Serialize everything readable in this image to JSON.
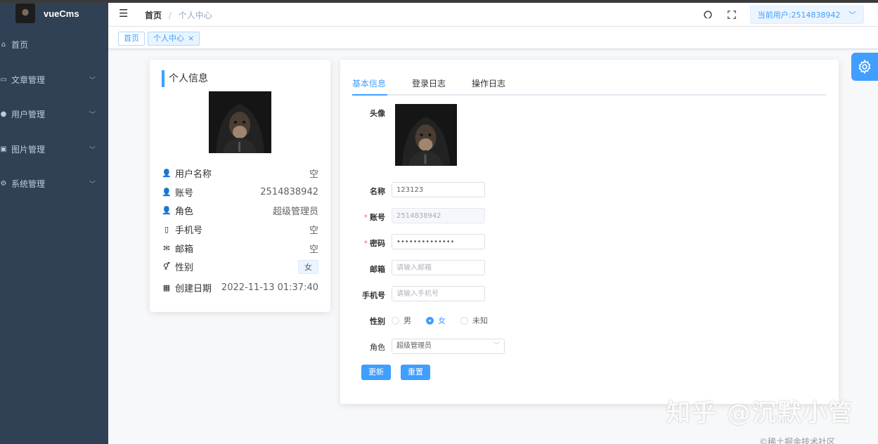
{
  "app": {
    "title": "vueCms"
  },
  "sidebar": {
    "items": [
      {
        "label": "首页",
        "icon": "home-icon",
        "has_sub": false
      },
      {
        "label": "文章管理",
        "icon": "article-icon",
        "has_sub": true
      },
      {
        "label": "用户管理",
        "icon": "user-icon",
        "has_sub": true
      },
      {
        "label": "图片管理",
        "icon": "image-icon",
        "has_sub": true
      },
      {
        "label": "系统管理",
        "icon": "settings-icon",
        "has_sub": true
      }
    ]
  },
  "header": {
    "breadcrumb": [
      "首页",
      "个人中心"
    ],
    "separator": "/",
    "current_user": "当前用户:2514838942"
  },
  "tags": {
    "home": "首页",
    "active": "个人中心",
    "close": "×"
  },
  "profile_card": {
    "title": "个人信息",
    "rows": [
      {
        "label": "用户名称",
        "value": "空",
        "icon": "user-icon"
      },
      {
        "label": "账号",
        "value": "2514838942",
        "icon": "user-icon"
      },
      {
        "label": "角色",
        "value": "超级管理员",
        "icon": "user-icon"
      },
      {
        "label": "手机号",
        "value": "空",
        "icon": "phone-icon"
      },
      {
        "label": "邮箱",
        "value": "空",
        "icon": "mail-icon"
      },
      {
        "label": "性别",
        "value": "女",
        "icon": "gender-icon"
      },
      {
        "label": "创建日期",
        "value": "2022-11-13 01:37:40",
        "icon": "calendar-icon"
      }
    ]
  },
  "tabs": [
    "基本信息",
    "登录日志",
    "操作日志"
  ],
  "form": {
    "avatar_label": "头像",
    "name_label": "名称",
    "name_value": "123123",
    "account_label": "账号",
    "account_value": "2514838942",
    "password_label": "密码",
    "password_value": "••••••••••••••",
    "email_label": "邮箱",
    "email_placeholder": "请输入邮箱",
    "phone_label": "手机号",
    "phone_placeholder": "请输入手机号",
    "gender_label": "性别",
    "gender_options": [
      "男",
      "女",
      "未知"
    ],
    "gender_selected": "女",
    "role_label": "角色",
    "role_value": "超级管理员",
    "update_button": "更新",
    "reset_button": "重置"
  },
  "watermark": "知乎 @沉默小管",
  "footer": "©稀土掘金技术社区",
  "colors": {
    "accent": "#409eff",
    "sidebar": "#304156",
    "required": "#f56c6c"
  }
}
